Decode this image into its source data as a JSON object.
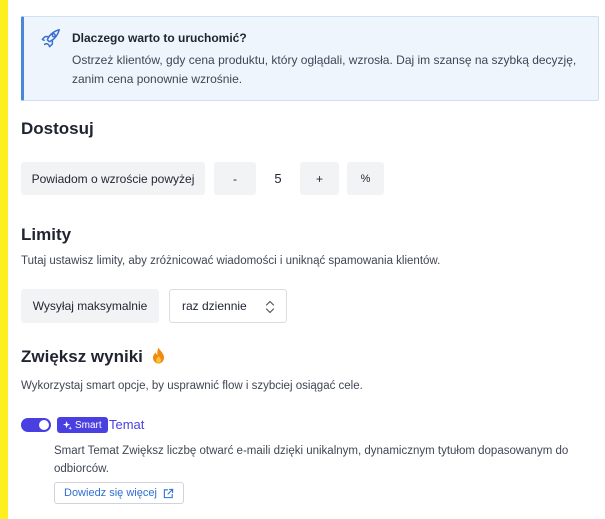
{
  "info": {
    "title": "Dlaczego warto to uruchomić?",
    "text": "Ostrzeż klientów, gdy cena produktu, który oglądali, wzrosła. Daj im szansę na szybką decyzję, zanim cena ponownie wzrośnie.",
    "icon": "rocket-icon"
  },
  "customize": {
    "heading": "Dostosuj",
    "label": "Powiadom o wzroście powyżej",
    "minus": "-",
    "value": "5",
    "plus": "+",
    "unit": "%"
  },
  "limits": {
    "heading": "Limity",
    "description": "Tutaj ustawisz limity, aby zróżnicować wiadomości i uniknąć spamowania klientów.",
    "label": "Wysyłaj maksymalnie",
    "select_value": "raz dziennie"
  },
  "boost": {
    "heading": "Zwiększ wyniki",
    "description": "Wykorzystaj smart opcje, by usprawnić flow i szybciej osiągać cele.",
    "badge": "Smart",
    "feature": "Temat",
    "feature_desc": "Smart Temat Zwiększ liczbę otwarć e-maili dzięki unikalnym, dynamicznym tytułom dopasowanym do odbiorców.",
    "link": "Dowiedz się więcej",
    "toggle_on": true
  },
  "colors": {
    "accent": "#4a3fe0",
    "page_border": "#fdf01e",
    "info_bg": "#eef5fd",
    "link": "#2f6fd0"
  }
}
